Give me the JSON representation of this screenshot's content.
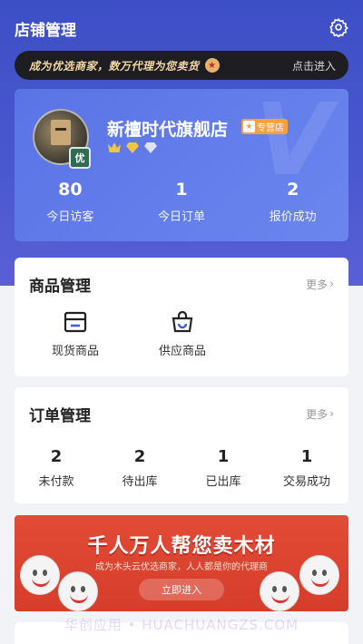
{
  "header": {
    "title": "店铺管理",
    "settings_icon": "gear-icon"
  },
  "promo": {
    "text": "成为优选商家，数万代理为您卖货",
    "action": "点击进入",
    "icon": "star-icon"
  },
  "store": {
    "name": "新檀时代旗舰店",
    "tag": "专营店",
    "avatar_badge": "优",
    "watermark": "V",
    "stats": [
      {
        "value": "80",
        "label": "今日访客"
      },
      {
        "value": "1",
        "label": "今日订单"
      },
      {
        "value": "2",
        "label": "报价成功"
      }
    ]
  },
  "goods": {
    "title": "商品管理",
    "more": "更多",
    "items": [
      {
        "label": "现货商品",
        "icon": "storage-box-icon"
      },
      {
        "label": "供应商品",
        "icon": "shopping-bag-icon"
      }
    ]
  },
  "orders": {
    "title": "订单管理",
    "more": "更多",
    "items": [
      {
        "value": "2",
        "label": "未付款"
      },
      {
        "value": "2",
        "label": "待出库"
      },
      {
        "value": "1",
        "label": "已出库"
      },
      {
        "value": "1",
        "label": "交易成功"
      }
    ]
  },
  "banner": {
    "title": "千人万人帮您卖木材",
    "subtitle": "成为木头云优选商家，人人都是你的代理商",
    "button": "立即进入"
  },
  "watermark": "华创应用 • HUACHUANGZS.COM",
  "colors": {
    "primary": "#3d4fc6",
    "card_blue": "#6b86ee",
    "banner_red": "#e24b36",
    "tag_orange": "#f6a23c"
  }
}
